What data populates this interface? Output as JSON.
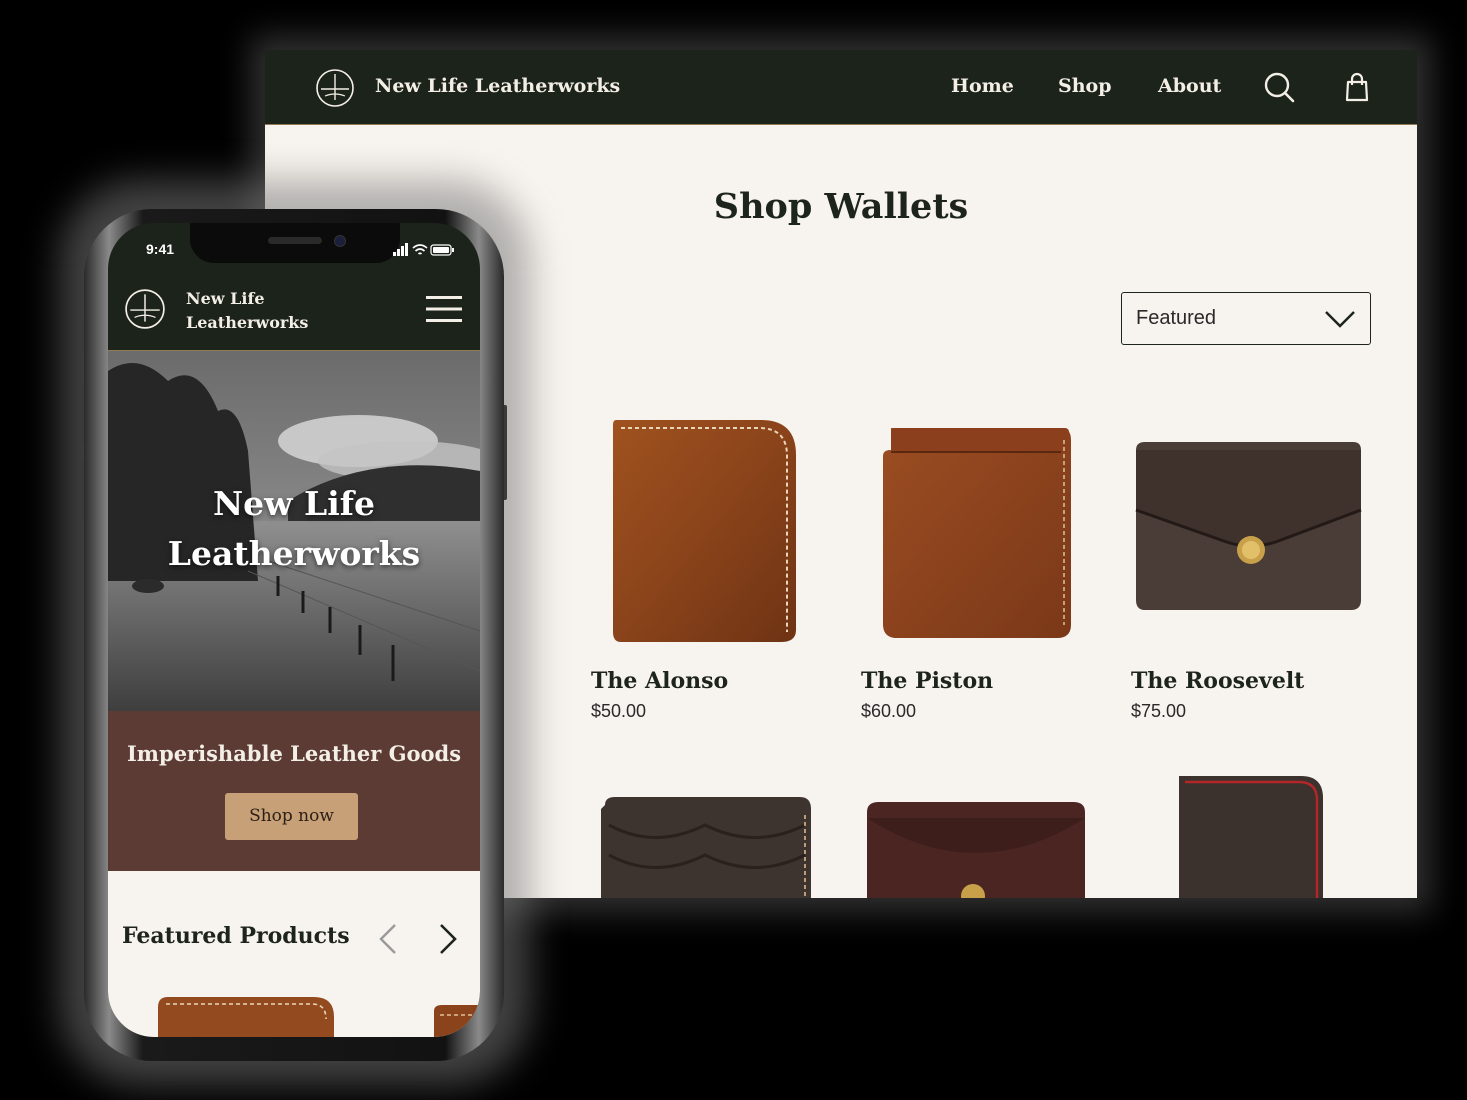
{
  "desktop": {
    "brand": "New Life Leatherworks",
    "nav": [
      {
        "label": "Home"
      },
      {
        "label": "Shop"
      },
      {
        "label": "About"
      }
    ],
    "icons": {
      "search": "search-icon",
      "cart": "shopping-bag-icon",
      "logo": "compass-logo-icon"
    },
    "page_title": "Shop Wallets",
    "sort": {
      "selected": "Featured"
    },
    "products": [
      {
        "name": "The Alonso",
        "price": "$50.00"
      },
      {
        "name": "The Piston",
        "price": "$60.00"
      },
      {
        "name": "The Roosevelt",
        "price": "$75.00"
      }
    ]
  },
  "mobile": {
    "status_time": "9:41",
    "brand_line1": "New Life",
    "brand_line2": "Leatherworks",
    "hero_line1": "New Life",
    "hero_line2": "Leatherworks",
    "tagline": "Imperishable Leather Goods",
    "cta": "Shop now",
    "featured_title": "Featured Products",
    "icons": {
      "menu": "hamburger-menu-icon",
      "prev": "chevron-left-icon",
      "next": "chevron-right-icon"
    }
  },
  "colors": {
    "header_bg": "#1c231b",
    "page_bg": "#f7f3ee",
    "band_bg": "#5b3b33",
    "cta_bg": "#c8a078",
    "text_dark": "#1d241c"
  }
}
